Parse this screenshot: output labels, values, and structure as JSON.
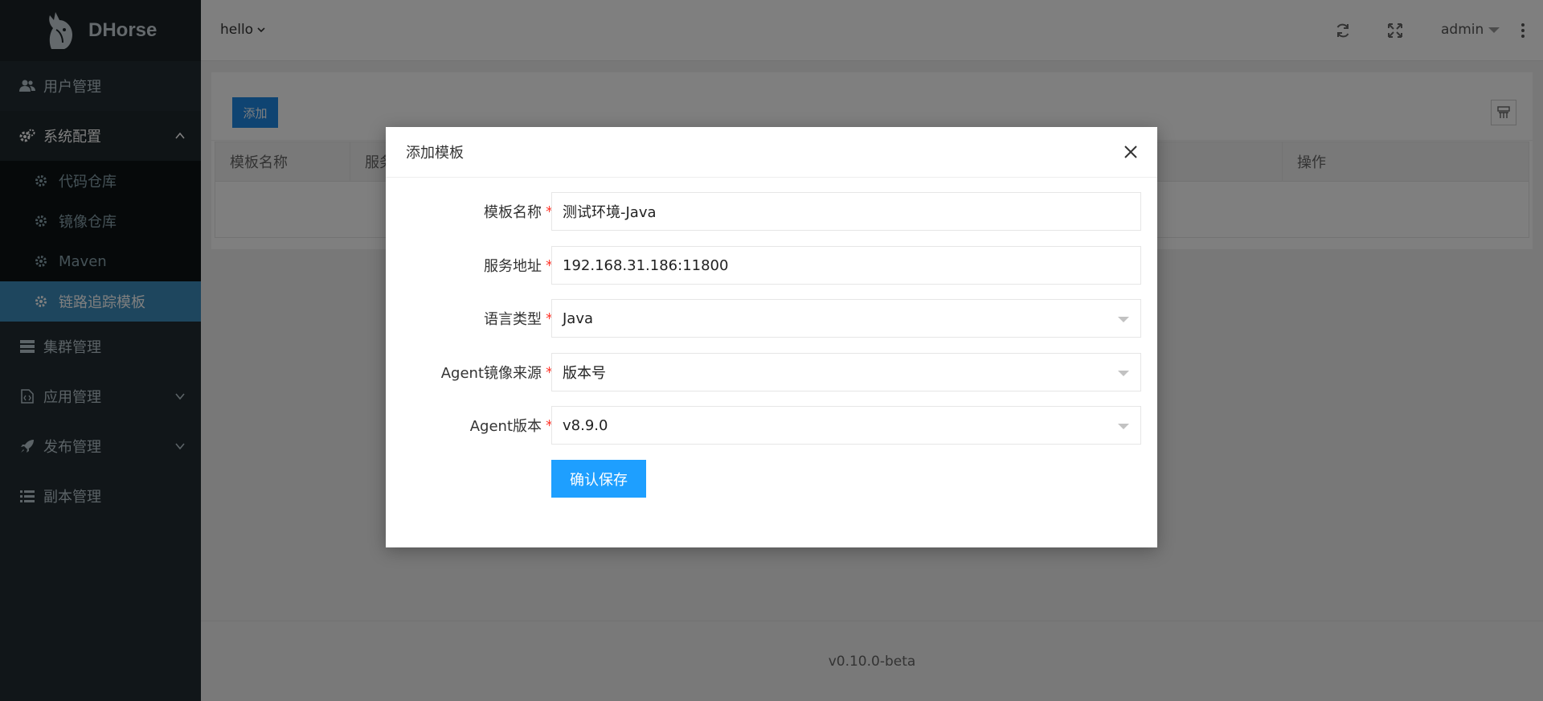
{
  "brand": {
    "name": "DHorse"
  },
  "sidebar": {
    "items": [
      {
        "label": "用户管理",
        "icon": "users-icon"
      },
      {
        "label": "系统配置",
        "icon": "cogs-icon",
        "expanded": true
      },
      {
        "label": "集群管理",
        "icon": "server-icon"
      },
      {
        "label": "应用管理",
        "icon": "file-code-icon"
      },
      {
        "label": "发布管理",
        "icon": "rocket-icon"
      },
      {
        "label": "副本管理",
        "icon": "list-icon"
      }
    ],
    "sub_items": [
      {
        "label": "代码仓库",
        "icon": "gear-icon"
      },
      {
        "label": "镜像仓库",
        "icon": "gear-icon"
      },
      {
        "label": "Maven",
        "icon": "gear-icon"
      },
      {
        "label": "链路追踪模板",
        "icon": "gear-icon",
        "active": true
      }
    ]
  },
  "header": {
    "workspace": "hello",
    "user": "admin"
  },
  "toolbar": {
    "add_label": "添加"
  },
  "table": {
    "headers": [
      "模板名称",
      "服务",
      "操作"
    ]
  },
  "footer": {
    "version": "v0.10.0-beta"
  },
  "modal": {
    "title": "添加模板",
    "fields": [
      {
        "label": "模板名称",
        "value": "测试环境-Java",
        "type": "text"
      },
      {
        "label": "服务地址",
        "value": "192.168.31.186:11800",
        "type": "text"
      },
      {
        "label": "语言类型",
        "value": "Java",
        "type": "select"
      },
      {
        "label": "Agent镜像来源",
        "value": "版本号",
        "type": "select"
      },
      {
        "label": "Agent版本",
        "value": "v8.9.0",
        "type": "select"
      }
    ],
    "save_label": "确认保存",
    "required_mark": "*"
  },
  "colors": {
    "sidebar_bg": "#222d32",
    "active_item": "#3c8dbc",
    "primary_button": "#1e9fff",
    "required": "#ff3b30"
  }
}
